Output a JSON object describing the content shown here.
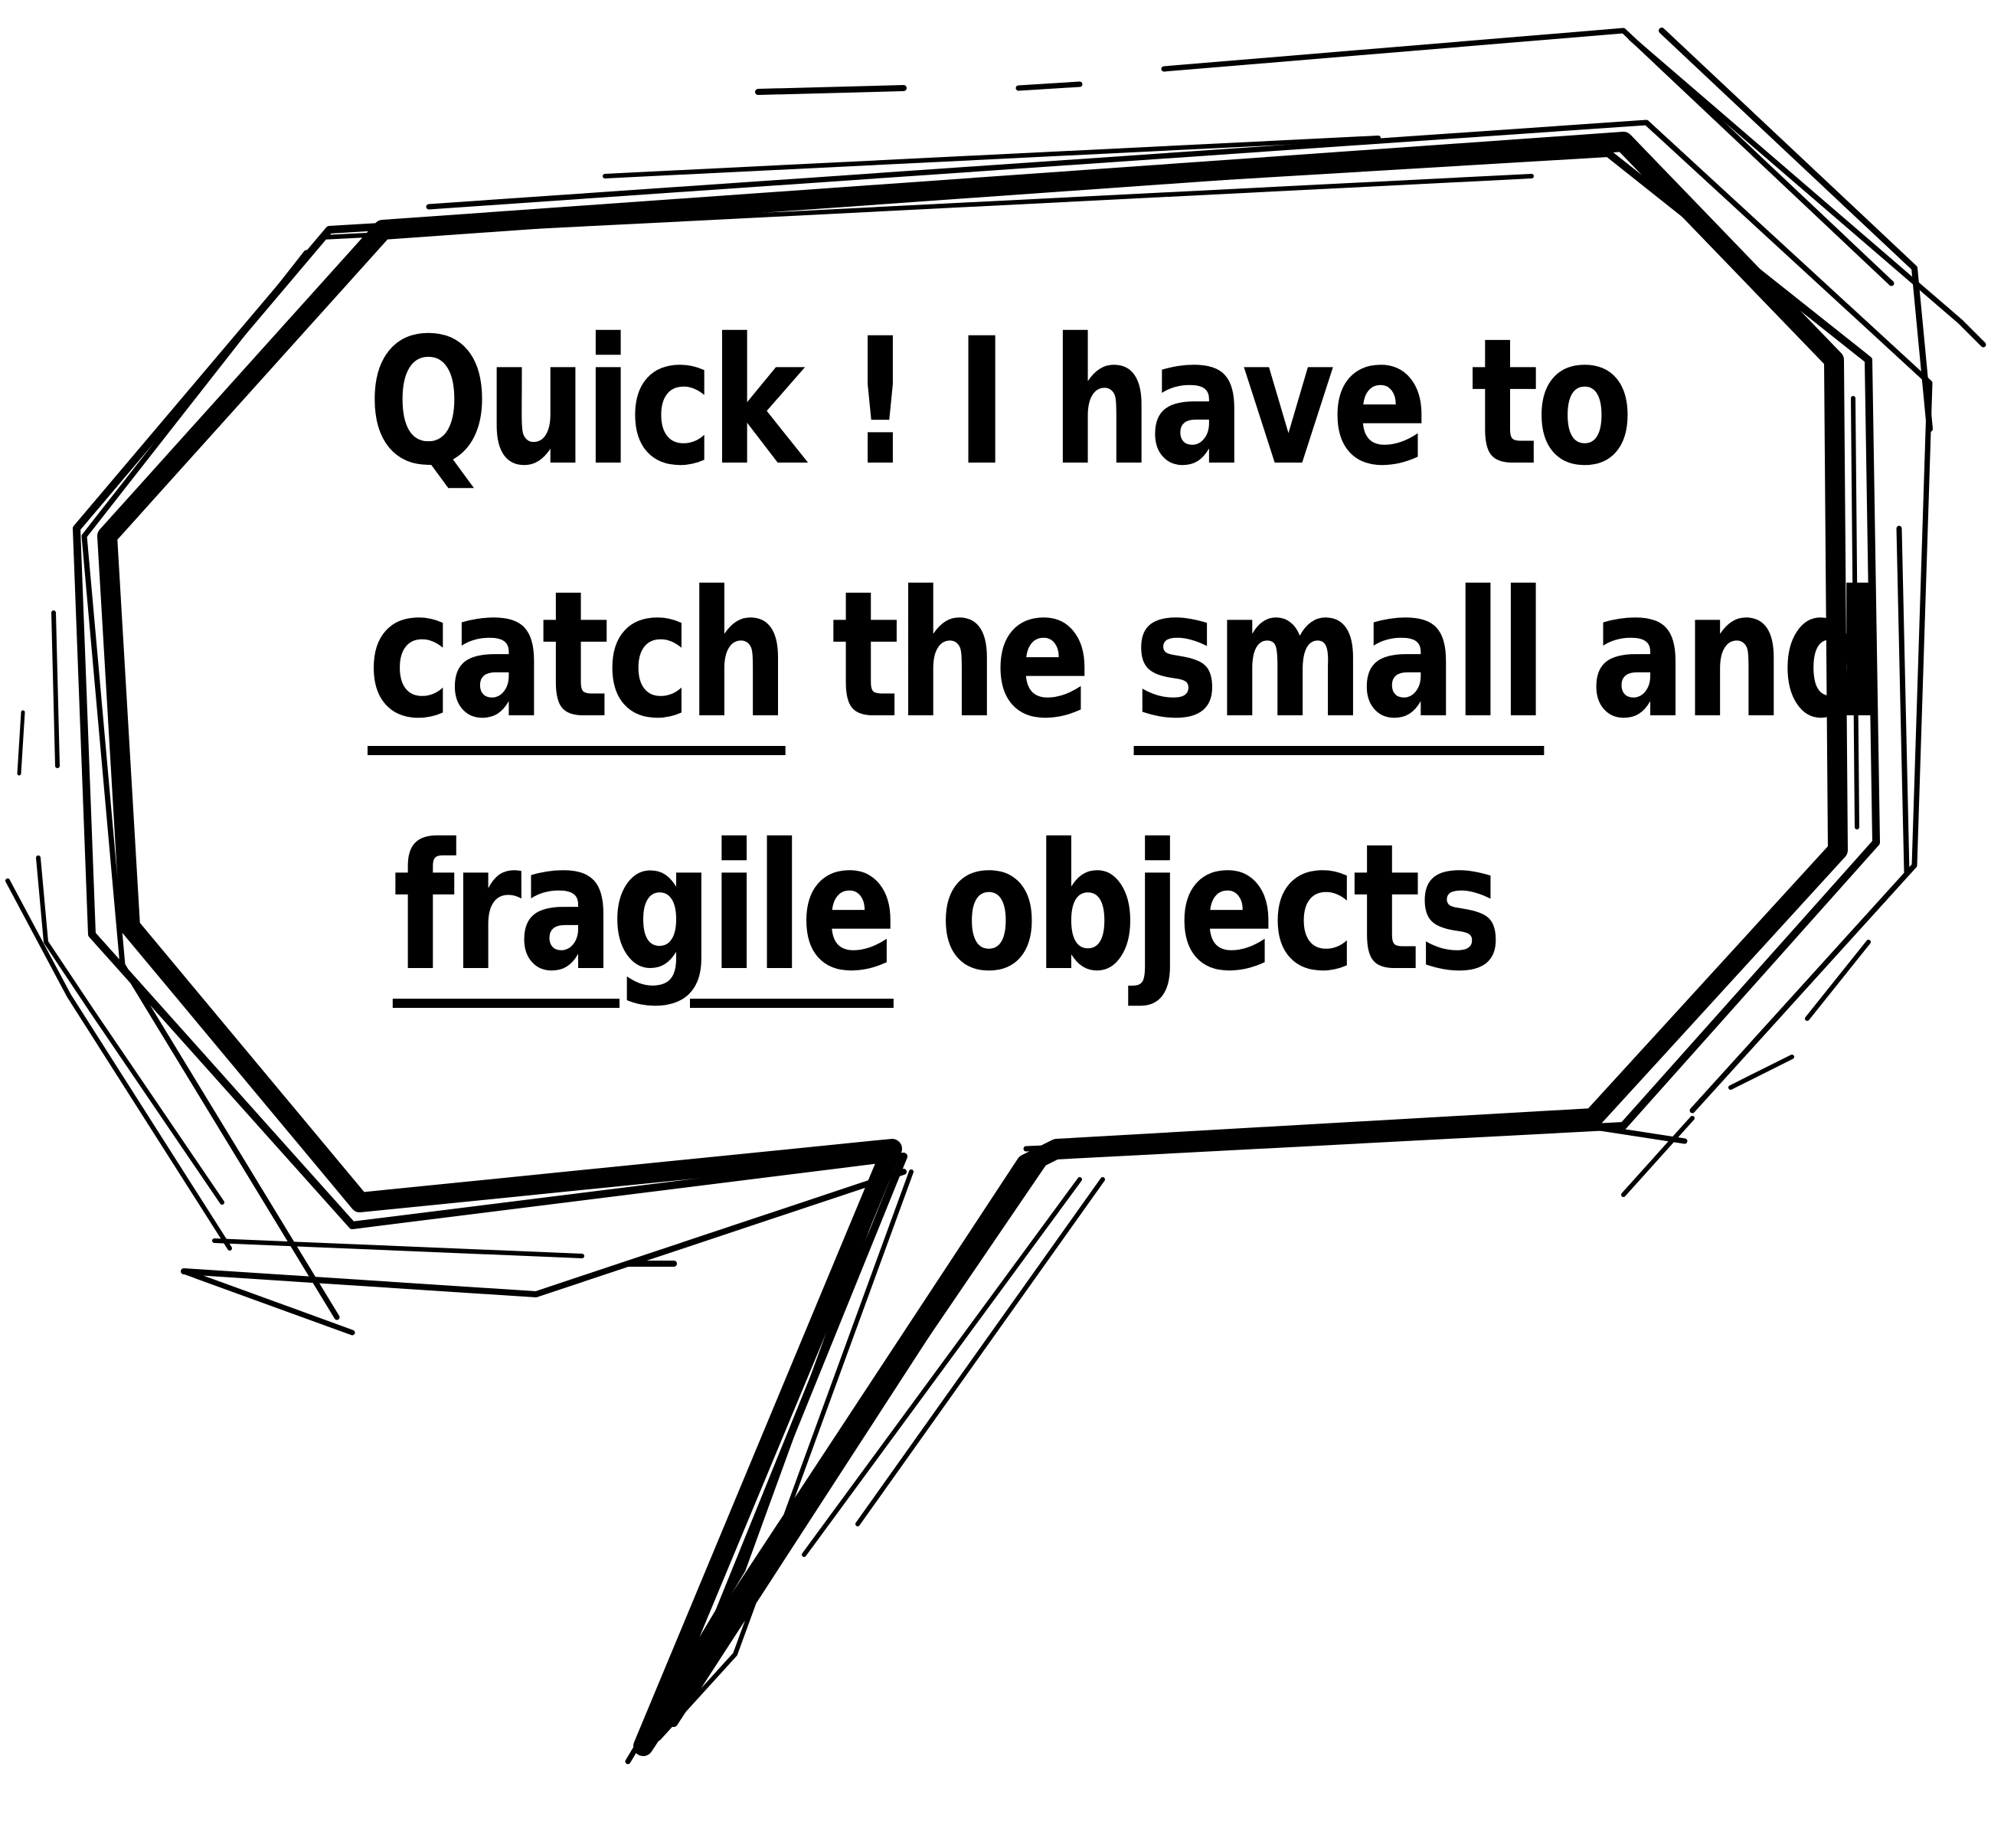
{
  "bubble": {
    "lines": [
      {
        "segments": [
          {
            "text": "Quick ! I have to",
            "underline": false
          }
        ]
      },
      {
        "segments": [
          {
            "text": "catch",
            "underline": true
          },
          {
            "text": " the ",
            "underline": false
          },
          {
            "text": "small",
            "underline": true
          },
          {
            "text": " and",
            "underline": false
          }
        ]
      },
      {
        "segments": [
          {
            "text": "fragile",
            "underline": true
          },
          {
            "text": " objects",
            "underline": false
          }
        ]
      }
    ],
    "ink_color": "#000000",
    "background_color": "#ffffff"
  }
}
